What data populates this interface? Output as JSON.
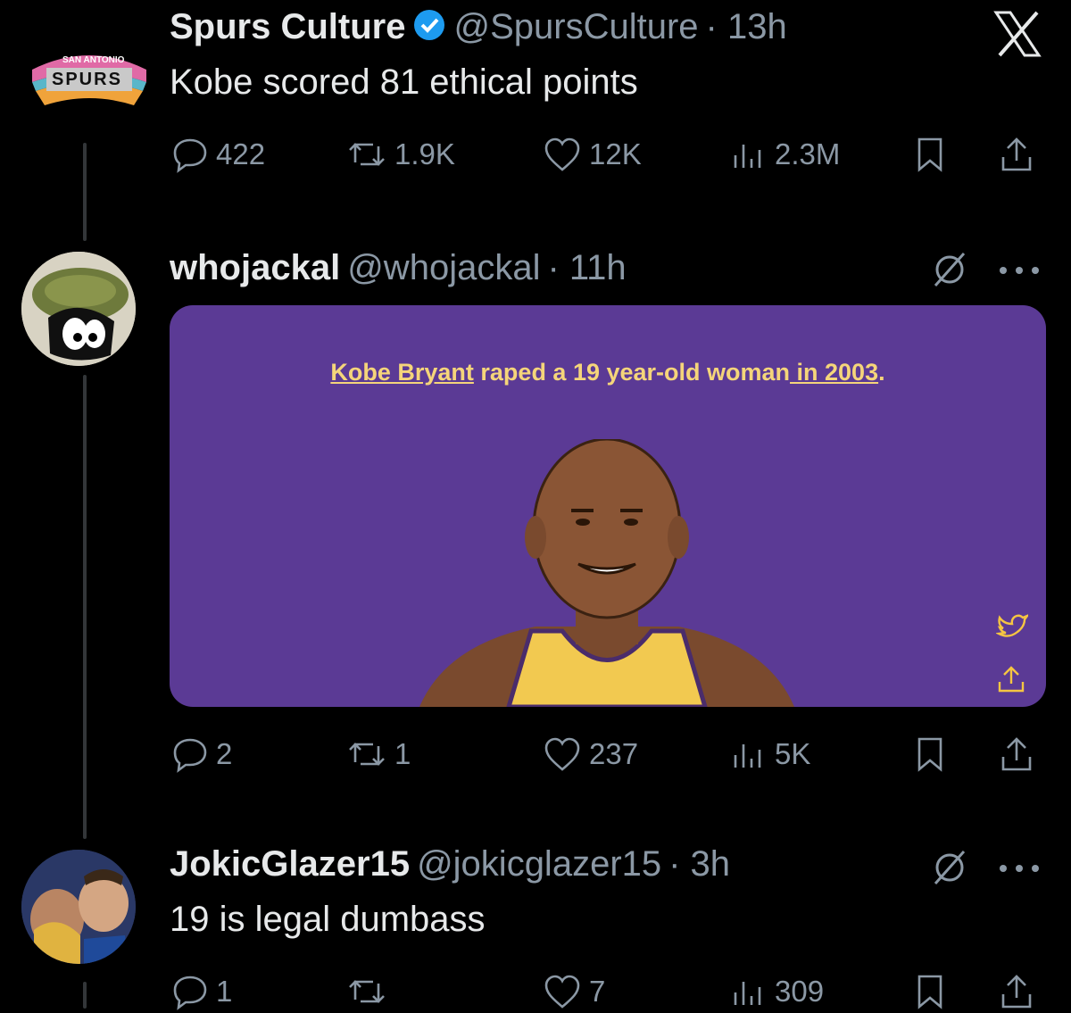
{
  "tweets": [
    {
      "name": "Spurs Culture",
      "handle": "@SpursCulture",
      "time": "· 13h",
      "text": "Kobe scored 81 ethical points",
      "stats": {
        "replies": "422",
        "retweets": "1.9K",
        "likes": "12K",
        "views": "2.3M"
      }
    },
    {
      "name": "whojackal",
      "handle": "@whojackal",
      "time": "· 11h",
      "media": {
        "caption_part1": "Kobe Bryant",
        "caption_part2": " raped a 19 year-old woman",
        "caption_part3": " in 2003",
        "caption_part4": "."
      },
      "stats": {
        "replies": "2",
        "retweets": "1",
        "likes": "237",
        "views": "5K"
      }
    },
    {
      "name": "JokicGlazer15",
      "handle": "@jokicglazer15",
      "time": "· 3h",
      "text": "19 is legal dumbass",
      "stats": {
        "replies": "1",
        "retweets": "",
        "likes": "7",
        "views": "309"
      }
    }
  ],
  "logo": {
    "top": "SAN ANTONIO",
    "main": "SPURS"
  },
  "icons": [
    "x-logo-icon",
    "verified-badge-icon",
    "reply-icon",
    "retweet-icon",
    "like-icon",
    "views-icon",
    "bookmark-icon",
    "share-icon",
    "grok-icon",
    "more-icon",
    "twitter-bird-icon"
  ],
  "colors": {
    "background": "#000000",
    "text": "#e7e9ea",
    "muted": "#8b98a5",
    "verified": "#1d9bf0",
    "media_bg": "#5b3a95",
    "media_caption": "#f5d57a"
  }
}
